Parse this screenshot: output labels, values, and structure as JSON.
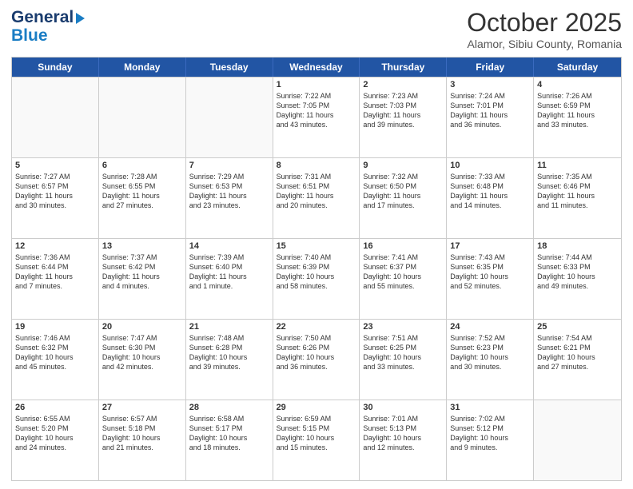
{
  "header": {
    "logo_general": "General",
    "logo_blue": "Blue",
    "month_title": "October 2025",
    "location": "Alamor, Sibiu County, Romania"
  },
  "days_of_week": [
    "Sunday",
    "Monday",
    "Tuesday",
    "Wednesday",
    "Thursday",
    "Friday",
    "Saturday"
  ],
  "weeks": [
    [
      {
        "num": "",
        "empty": true,
        "lines": []
      },
      {
        "num": "",
        "empty": true,
        "lines": []
      },
      {
        "num": "",
        "empty": true,
        "lines": []
      },
      {
        "num": "1",
        "lines": [
          "Sunrise: 7:22 AM",
          "Sunset: 7:05 PM",
          "Daylight: 11 hours",
          "and 43 minutes."
        ]
      },
      {
        "num": "2",
        "lines": [
          "Sunrise: 7:23 AM",
          "Sunset: 7:03 PM",
          "Daylight: 11 hours",
          "and 39 minutes."
        ]
      },
      {
        "num": "3",
        "lines": [
          "Sunrise: 7:24 AM",
          "Sunset: 7:01 PM",
          "Daylight: 11 hours",
          "and 36 minutes."
        ]
      },
      {
        "num": "4",
        "lines": [
          "Sunrise: 7:26 AM",
          "Sunset: 6:59 PM",
          "Daylight: 11 hours",
          "and 33 minutes."
        ]
      }
    ],
    [
      {
        "num": "5",
        "lines": [
          "Sunrise: 7:27 AM",
          "Sunset: 6:57 PM",
          "Daylight: 11 hours",
          "and 30 minutes."
        ]
      },
      {
        "num": "6",
        "lines": [
          "Sunrise: 7:28 AM",
          "Sunset: 6:55 PM",
          "Daylight: 11 hours",
          "and 27 minutes."
        ]
      },
      {
        "num": "7",
        "lines": [
          "Sunrise: 7:29 AM",
          "Sunset: 6:53 PM",
          "Daylight: 11 hours",
          "and 23 minutes."
        ]
      },
      {
        "num": "8",
        "lines": [
          "Sunrise: 7:31 AM",
          "Sunset: 6:51 PM",
          "Daylight: 11 hours",
          "and 20 minutes."
        ]
      },
      {
        "num": "9",
        "lines": [
          "Sunrise: 7:32 AM",
          "Sunset: 6:50 PM",
          "Daylight: 11 hours",
          "and 17 minutes."
        ]
      },
      {
        "num": "10",
        "lines": [
          "Sunrise: 7:33 AM",
          "Sunset: 6:48 PM",
          "Daylight: 11 hours",
          "and 14 minutes."
        ]
      },
      {
        "num": "11",
        "lines": [
          "Sunrise: 7:35 AM",
          "Sunset: 6:46 PM",
          "Daylight: 11 hours",
          "and 11 minutes."
        ]
      }
    ],
    [
      {
        "num": "12",
        "lines": [
          "Sunrise: 7:36 AM",
          "Sunset: 6:44 PM",
          "Daylight: 11 hours",
          "and 7 minutes."
        ]
      },
      {
        "num": "13",
        "lines": [
          "Sunrise: 7:37 AM",
          "Sunset: 6:42 PM",
          "Daylight: 11 hours",
          "and 4 minutes."
        ]
      },
      {
        "num": "14",
        "lines": [
          "Sunrise: 7:39 AM",
          "Sunset: 6:40 PM",
          "Daylight: 11 hours",
          "and 1 minute."
        ]
      },
      {
        "num": "15",
        "lines": [
          "Sunrise: 7:40 AM",
          "Sunset: 6:39 PM",
          "Daylight: 10 hours",
          "and 58 minutes."
        ]
      },
      {
        "num": "16",
        "lines": [
          "Sunrise: 7:41 AM",
          "Sunset: 6:37 PM",
          "Daylight: 10 hours",
          "and 55 minutes."
        ]
      },
      {
        "num": "17",
        "lines": [
          "Sunrise: 7:43 AM",
          "Sunset: 6:35 PM",
          "Daylight: 10 hours",
          "and 52 minutes."
        ]
      },
      {
        "num": "18",
        "lines": [
          "Sunrise: 7:44 AM",
          "Sunset: 6:33 PM",
          "Daylight: 10 hours",
          "and 49 minutes."
        ]
      }
    ],
    [
      {
        "num": "19",
        "lines": [
          "Sunrise: 7:46 AM",
          "Sunset: 6:32 PM",
          "Daylight: 10 hours",
          "and 45 minutes."
        ]
      },
      {
        "num": "20",
        "lines": [
          "Sunrise: 7:47 AM",
          "Sunset: 6:30 PM",
          "Daylight: 10 hours",
          "and 42 minutes."
        ]
      },
      {
        "num": "21",
        "lines": [
          "Sunrise: 7:48 AM",
          "Sunset: 6:28 PM",
          "Daylight: 10 hours",
          "and 39 minutes."
        ]
      },
      {
        "num": "22",
        "lines": [
          "Sunrise: 7:50 AM",
          "Sunset: 6:26 PM",
          "Daylight: 10 hours",
          "and 36 minutes."
        ]
      },
      {
        "num": "23",
        "lines": [
          "Sunrise: 7:51 AM",
          "Sunset: 6:25 PM",
          "Daylight: 10 hours",
          "and 33 minutes."
        ]
      },
      {
        "num": "24",
        "lines": [
          "Sunrise: 7:52 AM",
          "Sunset: 6:23 PM",
          "Daylight: 10 hours",
          "and 30 minutes."
        ]
      },
      {
        "num": "25",
        "lines": [
          "Sunrise: 7:54 AM",
          "Sunset: 6:21 PM",
          "Daylight: 10 hours",
          "and 27 minutes."
        ]
      }
    ],
    [
      {
        "num": "26",
        "lines": [
          "Sunrise: 6:55 AM",
          "Sunset: 5:20 PM",
          "Daylight: 10 hours",
          "and 24 minutes."
        ]
      },
      {
        "num": "27",
        "lines": [
          "Sunrise: 6:57 AM",
          "Sunset: 5:18 PM",
          "Daylight: 10 hours",
          "and 21 minutes."
        ]
      },
      {
        "num": "28",
        "lines": [
          "Sunrise: 6:58 AM",
          "Sunset: 5:17 PM",
          "Daylight: 10 hours",
          "and 18 minutes."
        ]
      },
      {
        "num": "29",
        "lines": [
          "Sunrise: 6:59 AM",
          "Sunset: 5:15 PM",
          "Daylight: 10 hours",
          "and 15 minutes."
        ]
      },
      {
        "num": "30",
        "lines": [
          "Sunrise: 7:01 AM",
          "Sunset: 5:13 PM",
          "Daylight: 10 hours",
          "and 12 minutes."
        ]
      },
      {
        "num": "31",
        "lines": [
          "Sunrise: 7:02 AM",
          "Sunset: 5:12 PM",
          "Daylight: 10 hours",
          "and 9 minutes."
        ]
      },
      {
        "num": "",
        "empty": true,
        "lines": []
      }
    ]
  ]
}
